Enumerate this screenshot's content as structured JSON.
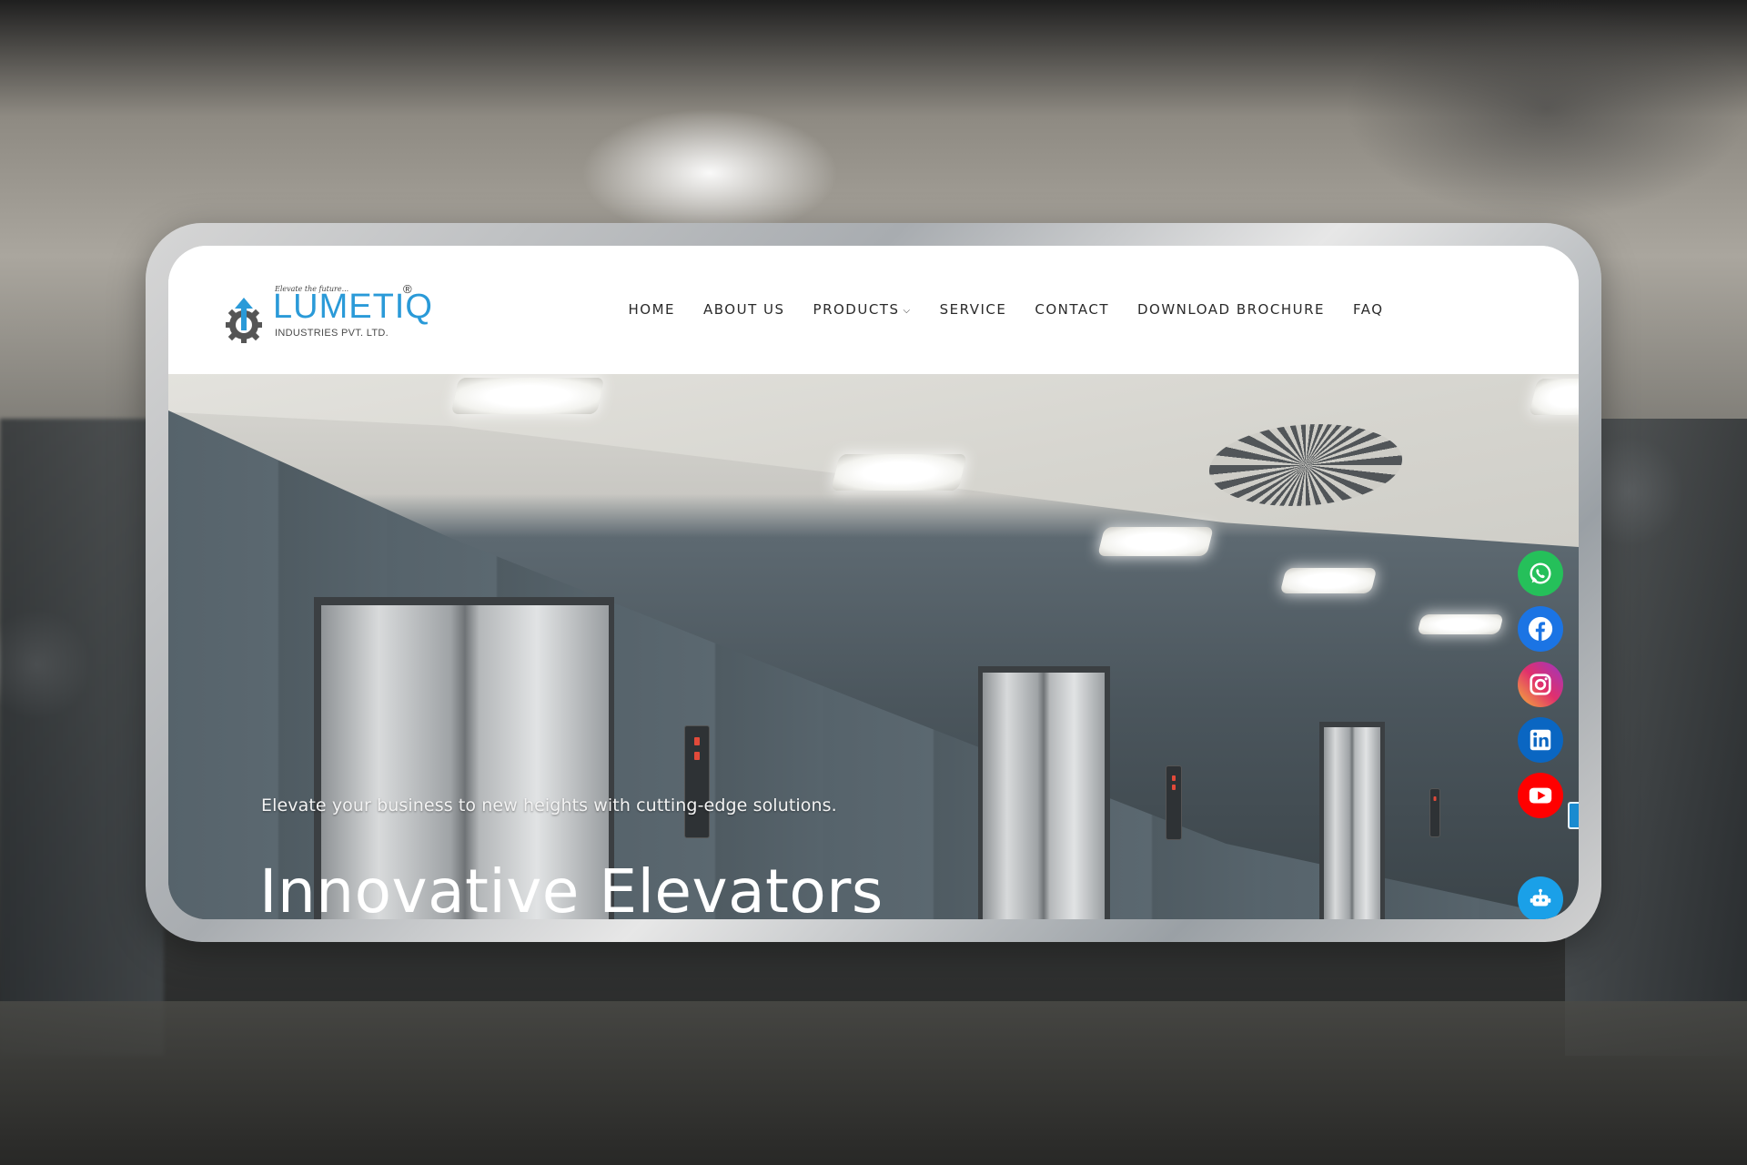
{
  "brand": {
    "name": "LUMETIQ",
    "tagline": "Elevate the future...",
    "subtitle": "INDUSTRIES PVT. LTD.",
    "registered_mark": "®",
    "color": "#2a9ad8"
  },
  "nav": {
    "items": [
      {
        "label": "HOME"
      },
      {
        "label": "ABOUT US"
      },
      {
        "label": "PRODUCTS",
        "has_dropdown": true,
        "dropdown_icon": "chevron-down-icon"
      },
      {
        "label": "SERVICE"
      },
      {
        "label": "CONTACT"
      },
      {
        "label": "DOWNLOAD BROCHURE"
      },
      {
        "label": "FAQ"
      }
    ]
  },
  "hero": {
    "subtitle": "Elevate your business to new heights with cutting-edge solutions.",
    "title": "Innovative Elevators",
    "floor_indicators": [
      "2",
      "2",
      "2"
    ]
  },
  "social": {
    "items": [
      {
        "icon": "whatsapp-icon",
        "color": "#25c05a"
      },
      {
        "icon": "facebook-icon",
        "color": "#1b74e4"
      },
      {
        "icon": "instagram-icon",
        "color": "#e1306c"
      },
      {
        "icon": "linkedin-icon",
        "color": "#0a66c2"
      },
      {
        "icon": "youtube-icon",
        "color": "#ff0000"
      }
    ],
    "chatbot_icon": "chatbot-icon",
    "chatbot_color": "#1aa0e8"
  }
}
